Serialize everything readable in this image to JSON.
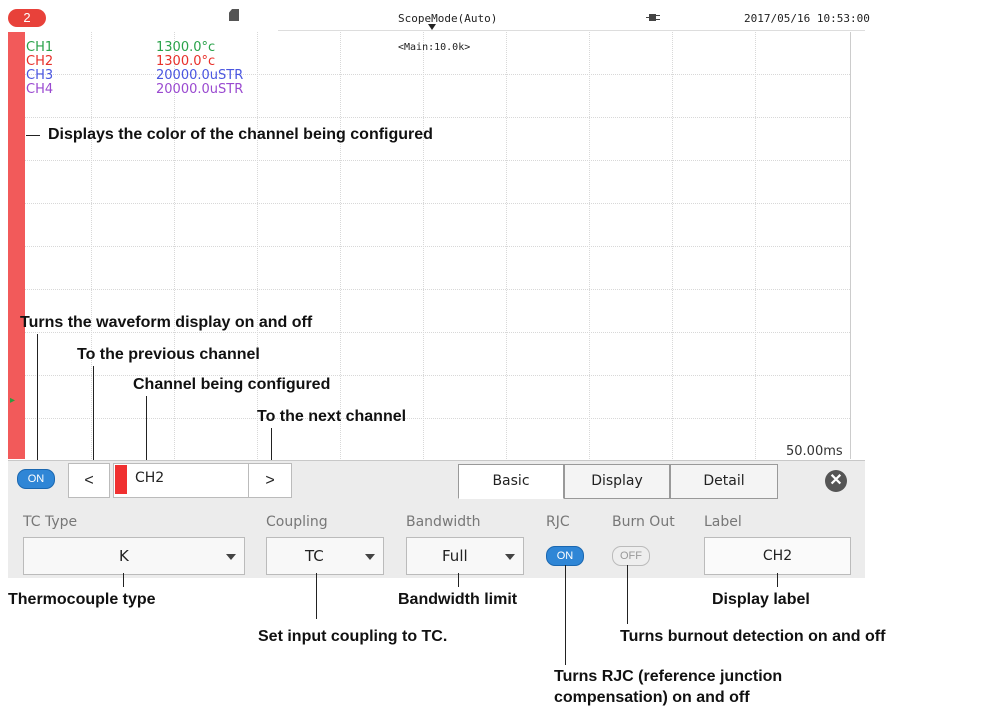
{
  "status": {
    "badge": "2",
    "mode": "ScopeMode(Auto)",
    "datetime": "2017/05/16 10:53:00"
  },
  "waveform": {
    "channels": [
      {
        "name": "CH1",
        "value": "1300.0°c",
        "color": "#2aa24a"
      },
      {
        "name": "CH2",
        "value": "1300.0°c",
        "color": "#e8302a"
      },
      {
        "name": "CH3",
        "value": "20000.0uSTR",
        "color": "#4a56e0"
      },
      {
        "name": "CH4",
        "value": "20000.0uSTR",
        "color": "#9a4ad0"
      }
    ],
    "main_info": "<Main:10.0k>",
    "time_div": "50.00ms"
  },
  "annotations": {
    "channel_color": "Displays the color of the channel being configured",
    "wave_toggle": "Turns the waveform display on and off",
    "prev_channel": "To the previous channel",
    "channel_config": "Channel being configured",
    "next_channel": "To the next channel",
    "tc_type": "Thermocouple type",
    "coupling": "Set input coupling to TC.",
    "bandwidth": "Bandwidth limit",
    "rjc_line1": "Turns RJC (reference junction",
    "rjc_line2": "compensation) on and off",
    "burnout": "Turns burnout detection on and off",
    "label": "Display label"
  },
  "panel": {
    "display_toggle": "ON",
    "prev": "<",
    "next": ">",
    "channel": "CH2",
    "tabs": [
      "Basic",
      "Display",
      "Detail"
    ],
    "tc_type": {
      "label": "TC Type",
      "value": "K"
    },
    "coupling": {
      "label": "Coupling",
      "value": "TC"
    },
    "bandwidth": {
      "label": "Bandwidth",
      "value": "Full"
    },
    "rjc": {
      "label": "RJC",
      "value": "ON"
    },
    "burnout": {
      "label": "Burn Out",
      "value": "OFF"
    },
    "display_label": {
      "label": "Label",
      "value": "CH2"
    }
  }
}
